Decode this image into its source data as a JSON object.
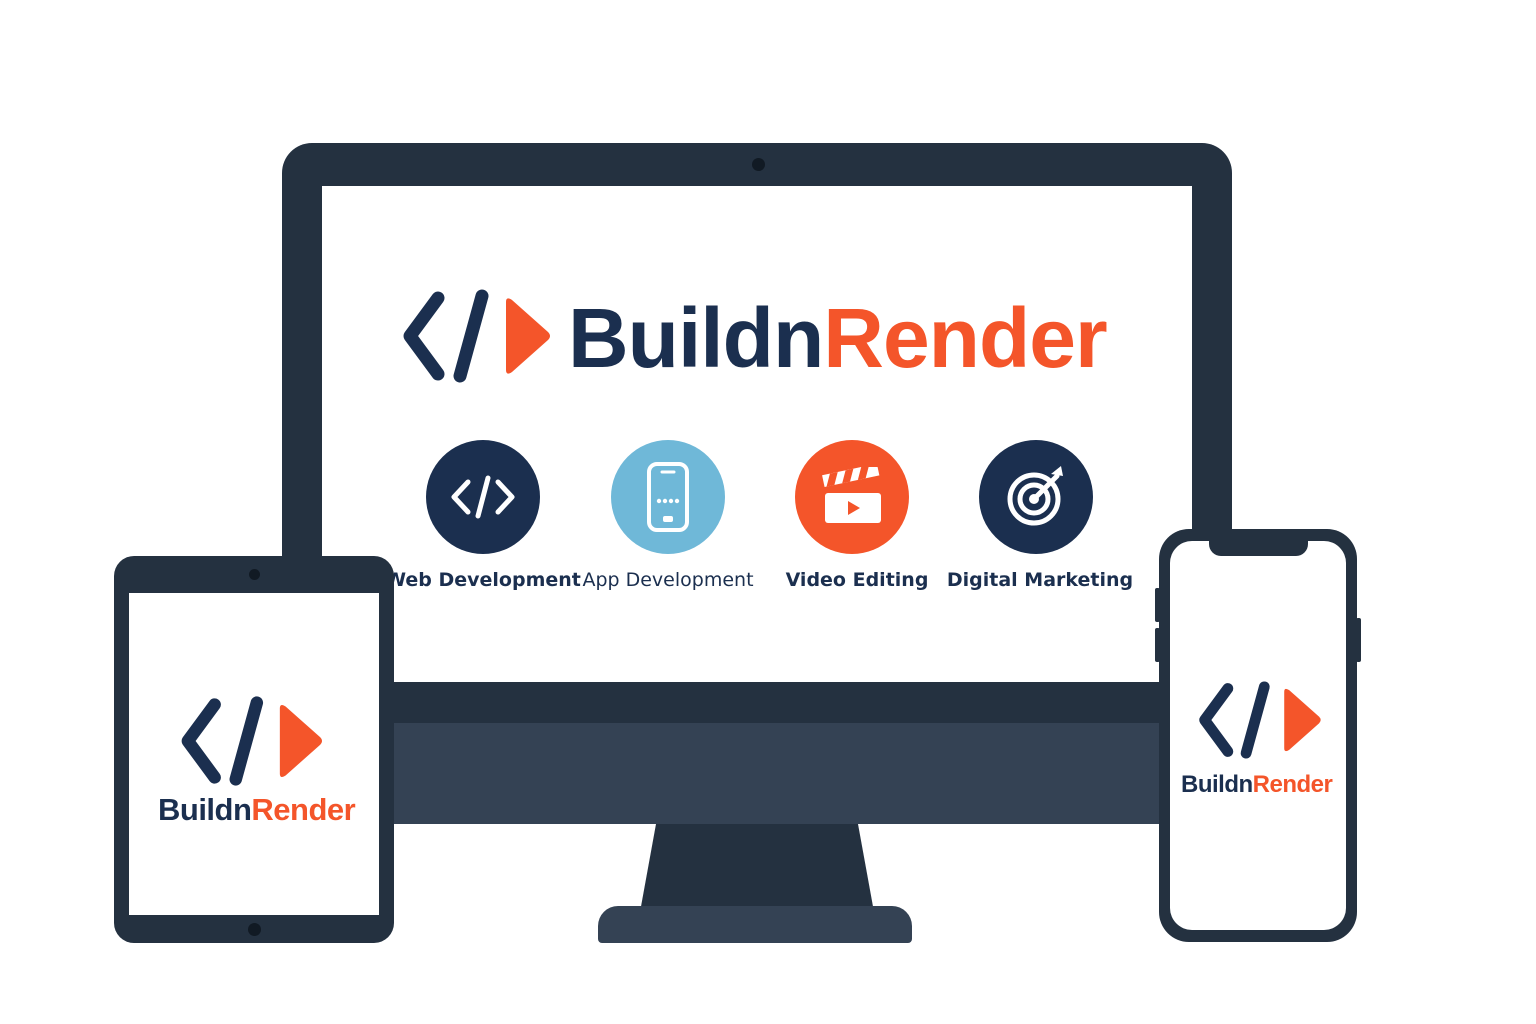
{
  "brand": {
    "name_part1": "Buildn",
    "name_part2": "Render",
    "colors": {
      "dark": "#1b2f4f",
      "orange": "#f4552a",
      "device": "#243140",
      "light_blue": "#6fb8d8"
    }
  },
  "services": [
    {
      "label": "Web Development",
      "icon": "code-icon",
      "circle_color": "#1b2f4f"
    },
    {
      "label": "App Development",
      "icon": "smartphone-icon",
      "circle_color": "#6fb8d8"
    },
    {
      "label": "Video Editing",
      "icon": "clapperboard-icon",
      "circle_color": "#f4552a"
    },
    {
      "label": "Digital Marketing",
      "icon": "target-icon",
      "circle_color": "#1b2f4f"
    }
  ],
  "tablet": {
    "brand_part1": "Buildn",
    "brand_part2": "Render"
  },
  "phone": {
    "brand_part1": "Buildn",
    "brand_part2": "Render"
  }
}
